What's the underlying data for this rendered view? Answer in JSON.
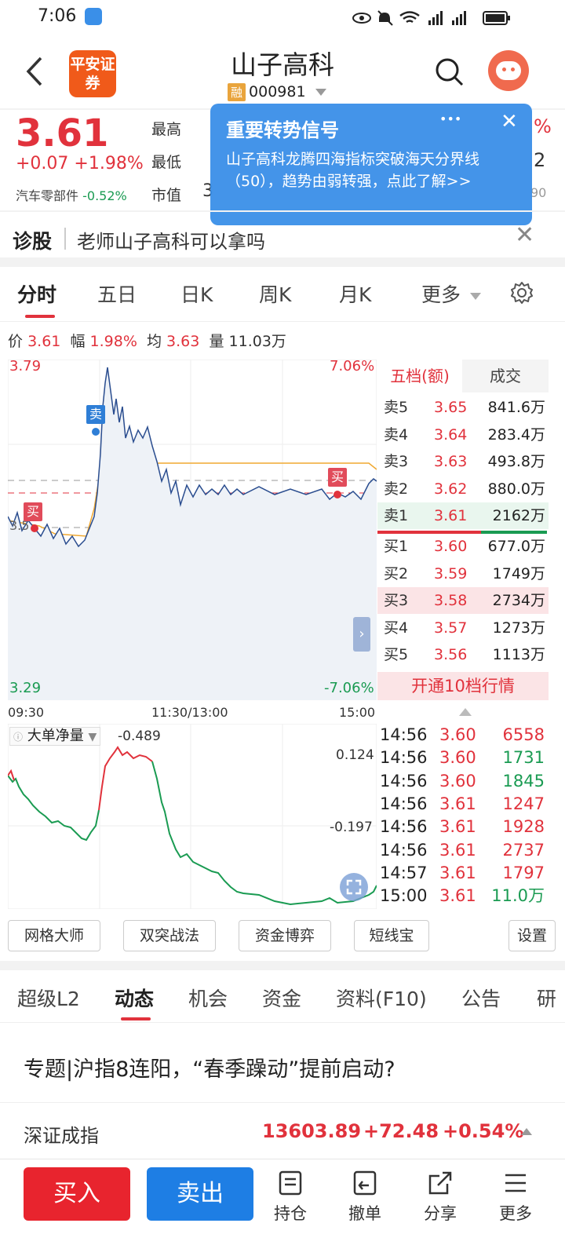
{
  "status": {
    "time": "7:06"
  },
  "header": {
    "logo_text": "平安证券",
    "title": "山子高科",
    "rong_badge": "融",
    "code": "000981"
  },
  "quote": {
    "price": "3.61",
    "change": "+0.07",
    "change_pct": "+1.98%",
    "sector": "汽车零部件",
    "sector_pct": "-0.52%",
    "labels": {
      "high": "最高",
      "low": "最低",
      "mcap": "市值"
    },
    "mcap_value_partial": "3",
    "right_partial_1": "%",
    "right_partial_2": "2",
    "right_partial_3": "90"
  },
  "popup": {
    "title": "重要转势信号",
    "body": "山子高科龙腾四海指标突破海天分界线（50），趋势由弱转强，点此了解>>",
    "more": "•••",
    "close": "✕"
  },
  "diagnose": {
    "label": "诊股",
    "text": "老师山子高科可以拿吗",
    "close": "✕"
  },
  "chart_tabs": [
    "分时",
    "五日",
    "日K",
    "周K",
    "月K",
    "更多"
  ],
  "info": {
    "p_label": "价",
    "p": "3.61",
    "f_label": "幅",
    "f": "1.98%",
    "j_label": "均",
    "j": "3.63",
    "l_label": "量",
    "l": "11.03万"
  },
  "intraday": {
    "high_label": "3.79",
    "low_label": "3.29",
    "up_pct": "7.06%",
    "down_pct": "-7.06%",
    "ref_label": "3.5",
    "sell_marker": "卖",
    "buy_marker": "买",
    "buy_marker2": "买",
    "time_start": "09:30",
    "time_mid": "11:30/13:00",
    "time_end": "15:00"
  },
  "depth": {
    "tabs": [
      "五档(额)",
      "成交"
    ],
    "sells": [
      {
        "label": "卖5",
        "price": "3.65",
        "vol": "841.6万"
      },
      {
        "label": "卖4",
        "price": "3.64",
        "vol": "283.4万"
      },
      {
        "label": "卖3",
        "price": "3.63",
        "vol": "493.8万"
      },
      {
        "label": "卖2",
        "price": "3.62",
        "vol": "880.0万"
      },
      {
        "label": "卖1",
        "price": "3.61",
        "vol": "2162万"
      }
    ],
    "buys": [
      {
        "label": "买1",
        "price": "3.60",
        "vol": "677.0万"
      },
      {
        "label": "买2",
        "price": "3.59",
        "vol": "1749万"
      },
      {
        "label": "买3",
        "price": "3.58",
        "vol": "2734万"
      },
      {
        "label": "买4",
        "price": "3.57",
        "vol": "1273万"
      },
      {
        "label": "买5",
        "price": "3.56",
        "vol": "1113万"
      }
    ],
    "open_l2": "开通10档行情"
  },
  "netflow": {
    "label": "大单净量",
    "value": "-0.489",
    "top": "0.124",
    "mid": "-0.197"
  },
  "ticks": [
    {
      "t": "14:56",
      "p": "3.60",
      "v": "6558",
      "c": "red"
    },
    {
      "t": "14:56",
      "p": "3.60",
      "v": "1731",
      "c": "green"
    },
    {
      "t": "14:56",
      "p": "3.60",
      "v": "1845",
      "c": "green"
    },
    {
      "t": "14:56",
      "p": "3.61",
      "v": "1247",
      "c": "red"
    },
    {
      "t": "14:56",
      "p": "3.61",
      "v": "1928",
      "c": "red"
    },
    {
      "t": "14:56",
      "p": "3.61",
      "v": "2737",
      "c": "red"
    },
    {
      "t": "14:57",
      "p": "3.61",
      "v": "1797",
      "c": "red"
    },
    {
      "t": "15:00",
      "p": "3.61",
      "v": "11.0万",
      "c": "green"
    }
  ],
  "tools": [
    "网格大师",
    "双突战法",
    "资金博弈",
    "短线宝",
    "设置"
  ],
  "info_tabs": [
    "超级L2",
    "动态",
    "机会",
    "资金",
    "资料(F10)",
    "公告",
    "研"
  ],
  "news": {
    "headline": "专题|沪指8连阳，“春季躁动”提前启动?"
  },
  "index": {
    "name": "深证成指",
    "value": "13603.89",
    "change": "+72.48",
    "pct": "+0.54%"
  },
  "bottom": {
    "buy": "买入",
    "sell": "卖出",
    "hold": "持仓",
    "cancel": "撤单",
    "share": "分享",
    "more": "更多"
  }
}
